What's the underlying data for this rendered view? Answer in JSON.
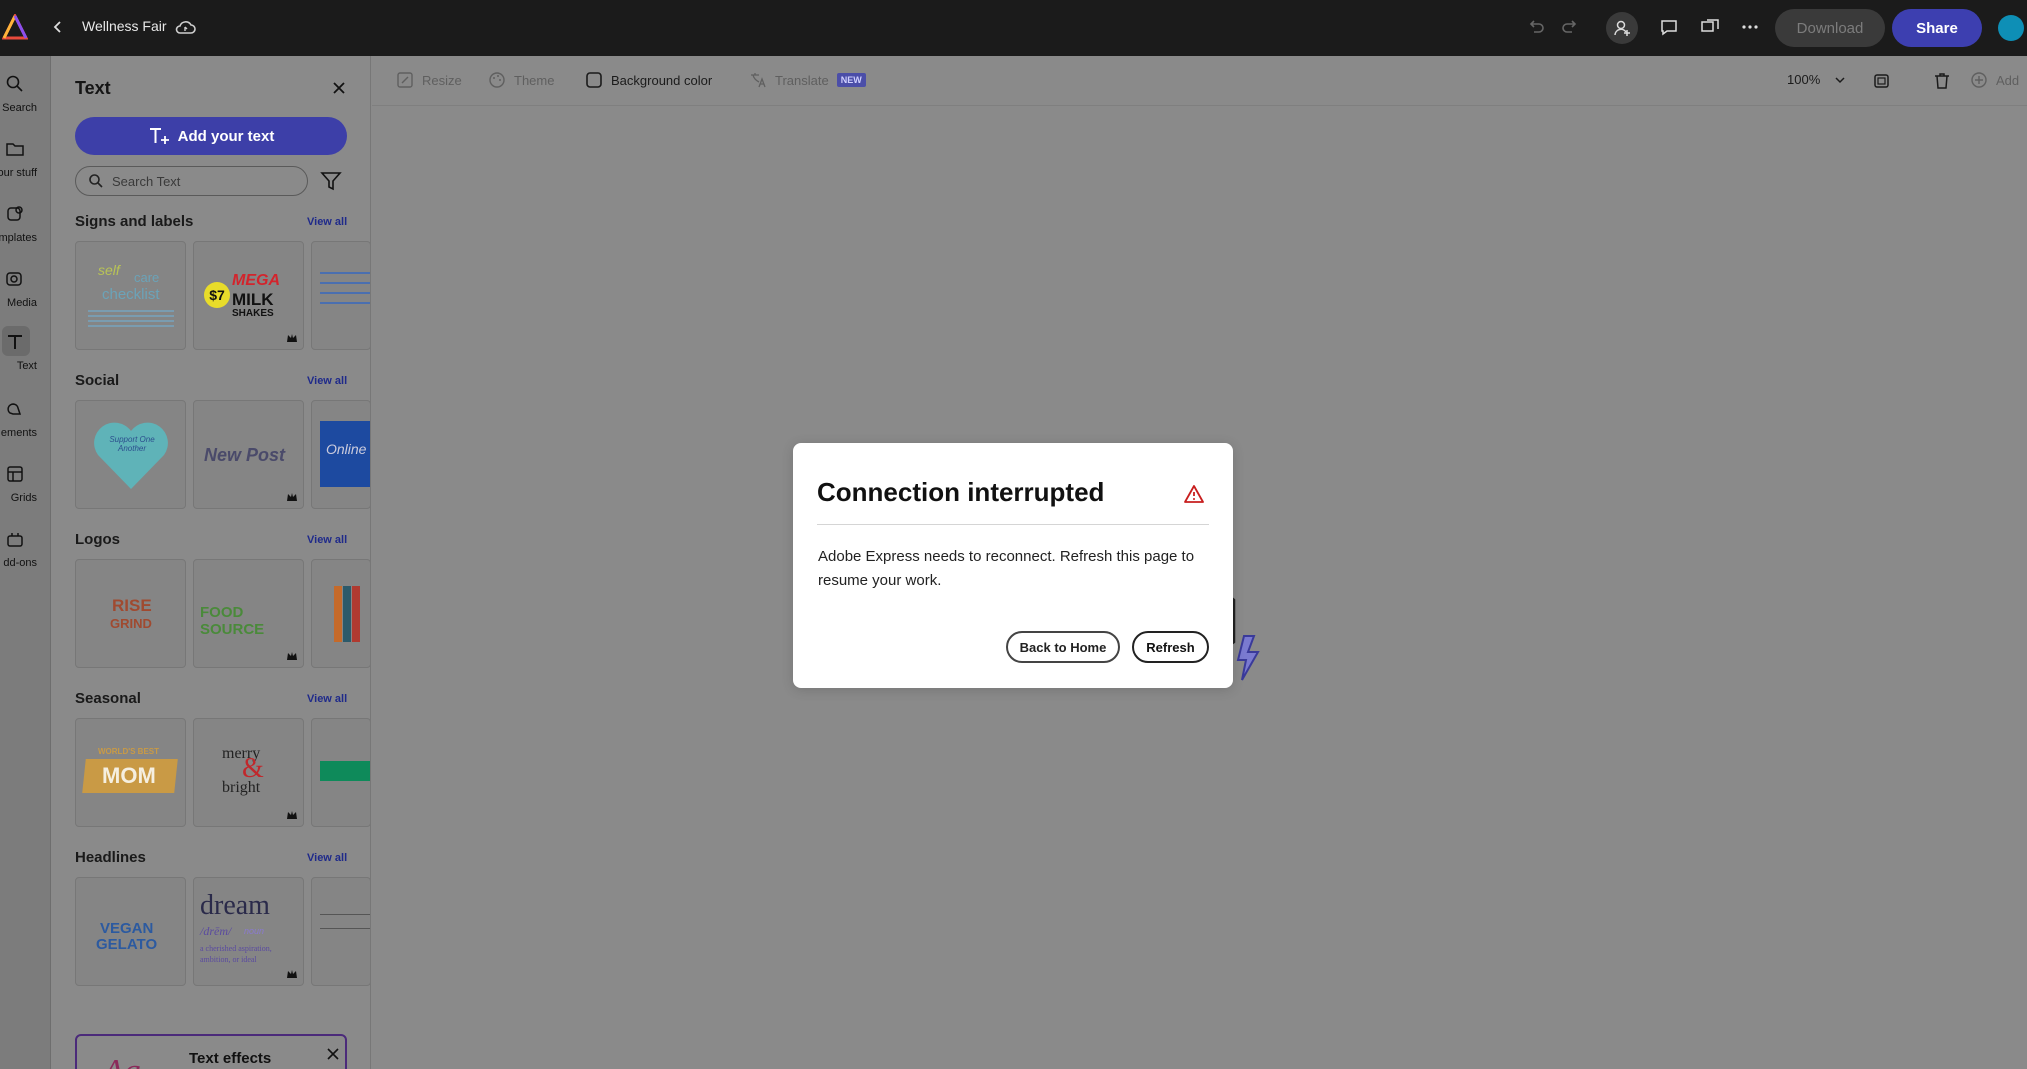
{
  "header": {
    "doc_title": "Wellness Fair",
    "download_label": "Download",
    "share_label": "Share"
  },
  "rail": {
    "items": [
      {
        "label": "Search",
        "icon": "search-icon"
      },
      {
        "label": "Your stuff",
        "icon": "folder-icon"
      },
      {
        "label": "Templates",
        "icon": "templates-icon"
      },
      {
        "label": "Media",
        "icon": "media-icon"
      },
      {
        "label": "Text",
        "icon": "text-icon"
      },
      {
        "label": "Elements",
        "icon": "elements-icon"
      },
      {
        "label": "Grids",
        "icon": "grids-icon"
      },
      {
        "label": "Add-ons",
        "icon": "addons-icon"
      }
    ],
    "visible_labels": [
      "Search",
      "our stuff",
      "mplates",
      "Media",
      "Text",
      "ements",
      "Grids",
      "dd-ons"
    ]
  },
  "panel": {
    "title": "Text",
    "add_text_label": "Add your text",
    "search_placeholder": "Search Text",
    "sections": [
      {
        "title": "Signs and labels",
        "view_all": "View all"
      },
      {
        "title": "Social",
        "view_all": "View all"
      },
      {
        "title": "Logos",
        "view_all": "View all"
      },
      {
        "title": "Seasonal",
        "view_all": "View all"
      },
      {
        "title": "Headlines",
        "view_all": "View all"
      }
    ],
    "thumb_text": {
      "self_care": [
        "self",
        "care",
        "checklist"
      ],
      "mega_price": "$7",
      "mega_words": [
        "MEGA",
        "MILK",
        "SHAKES"
      ],
      "heart": "Support One Another",
      "new_post": "New Post",
      "online": "Online",
      "rise_grind": [
        "RISE",
        "GRIND"
      ],
      "food_source": "FOOD SOURCE",
      "mom": [
        "WORLD'S BEST",
        "MOM"
      ],
      "merry": [
        "merry",
        "&",
        "bright"
      ],
      "vegan": [
        "VEGAN",
        "GELATO"
      ],
      "dream": [
        "dream",
        "/drēm/",
        "noun",
        "a cherished aspiration,",
        "ambition, or ideal"
      ]
    },
    "effects_card_title": "Text effects"
  },
  "canvas_toolbar": {
    "resize_label": "Resize",
    "theme_label": "Theme",
    "background_label": "Background color",
    "translate_label": "Translate",
    "new_badge": "NEW",
    "zoom_label": "100%",
    "add_label": "Add"
  },
  "modal": {
    "title": "Connection interrupted",
    "body": "Adobe Express needs to reconnect. Refresh this page to resume your work.",
    "back_home_label": "Back to Home",
    "refresh_label": "Refresh"
  },
  "colors": {
    "accent": "#3d3fa8",
    "topbar": "#1b1b1b",
    "overlay": "#8a8a8a"
  }
}
